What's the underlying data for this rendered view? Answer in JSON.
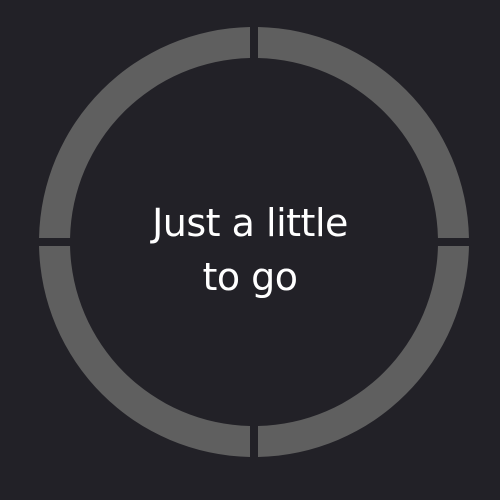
{
  "progress_indicator": {
    "segments_total": 4,
    "segments_completed": 0,
    "segment_color": "#5f5f5f",
    "completed_color": "#ffffff",
    "background_color": "#222127"
  },
  "message": {
    "line1": "Just a little",
    "line2": "to go"
  }
}
